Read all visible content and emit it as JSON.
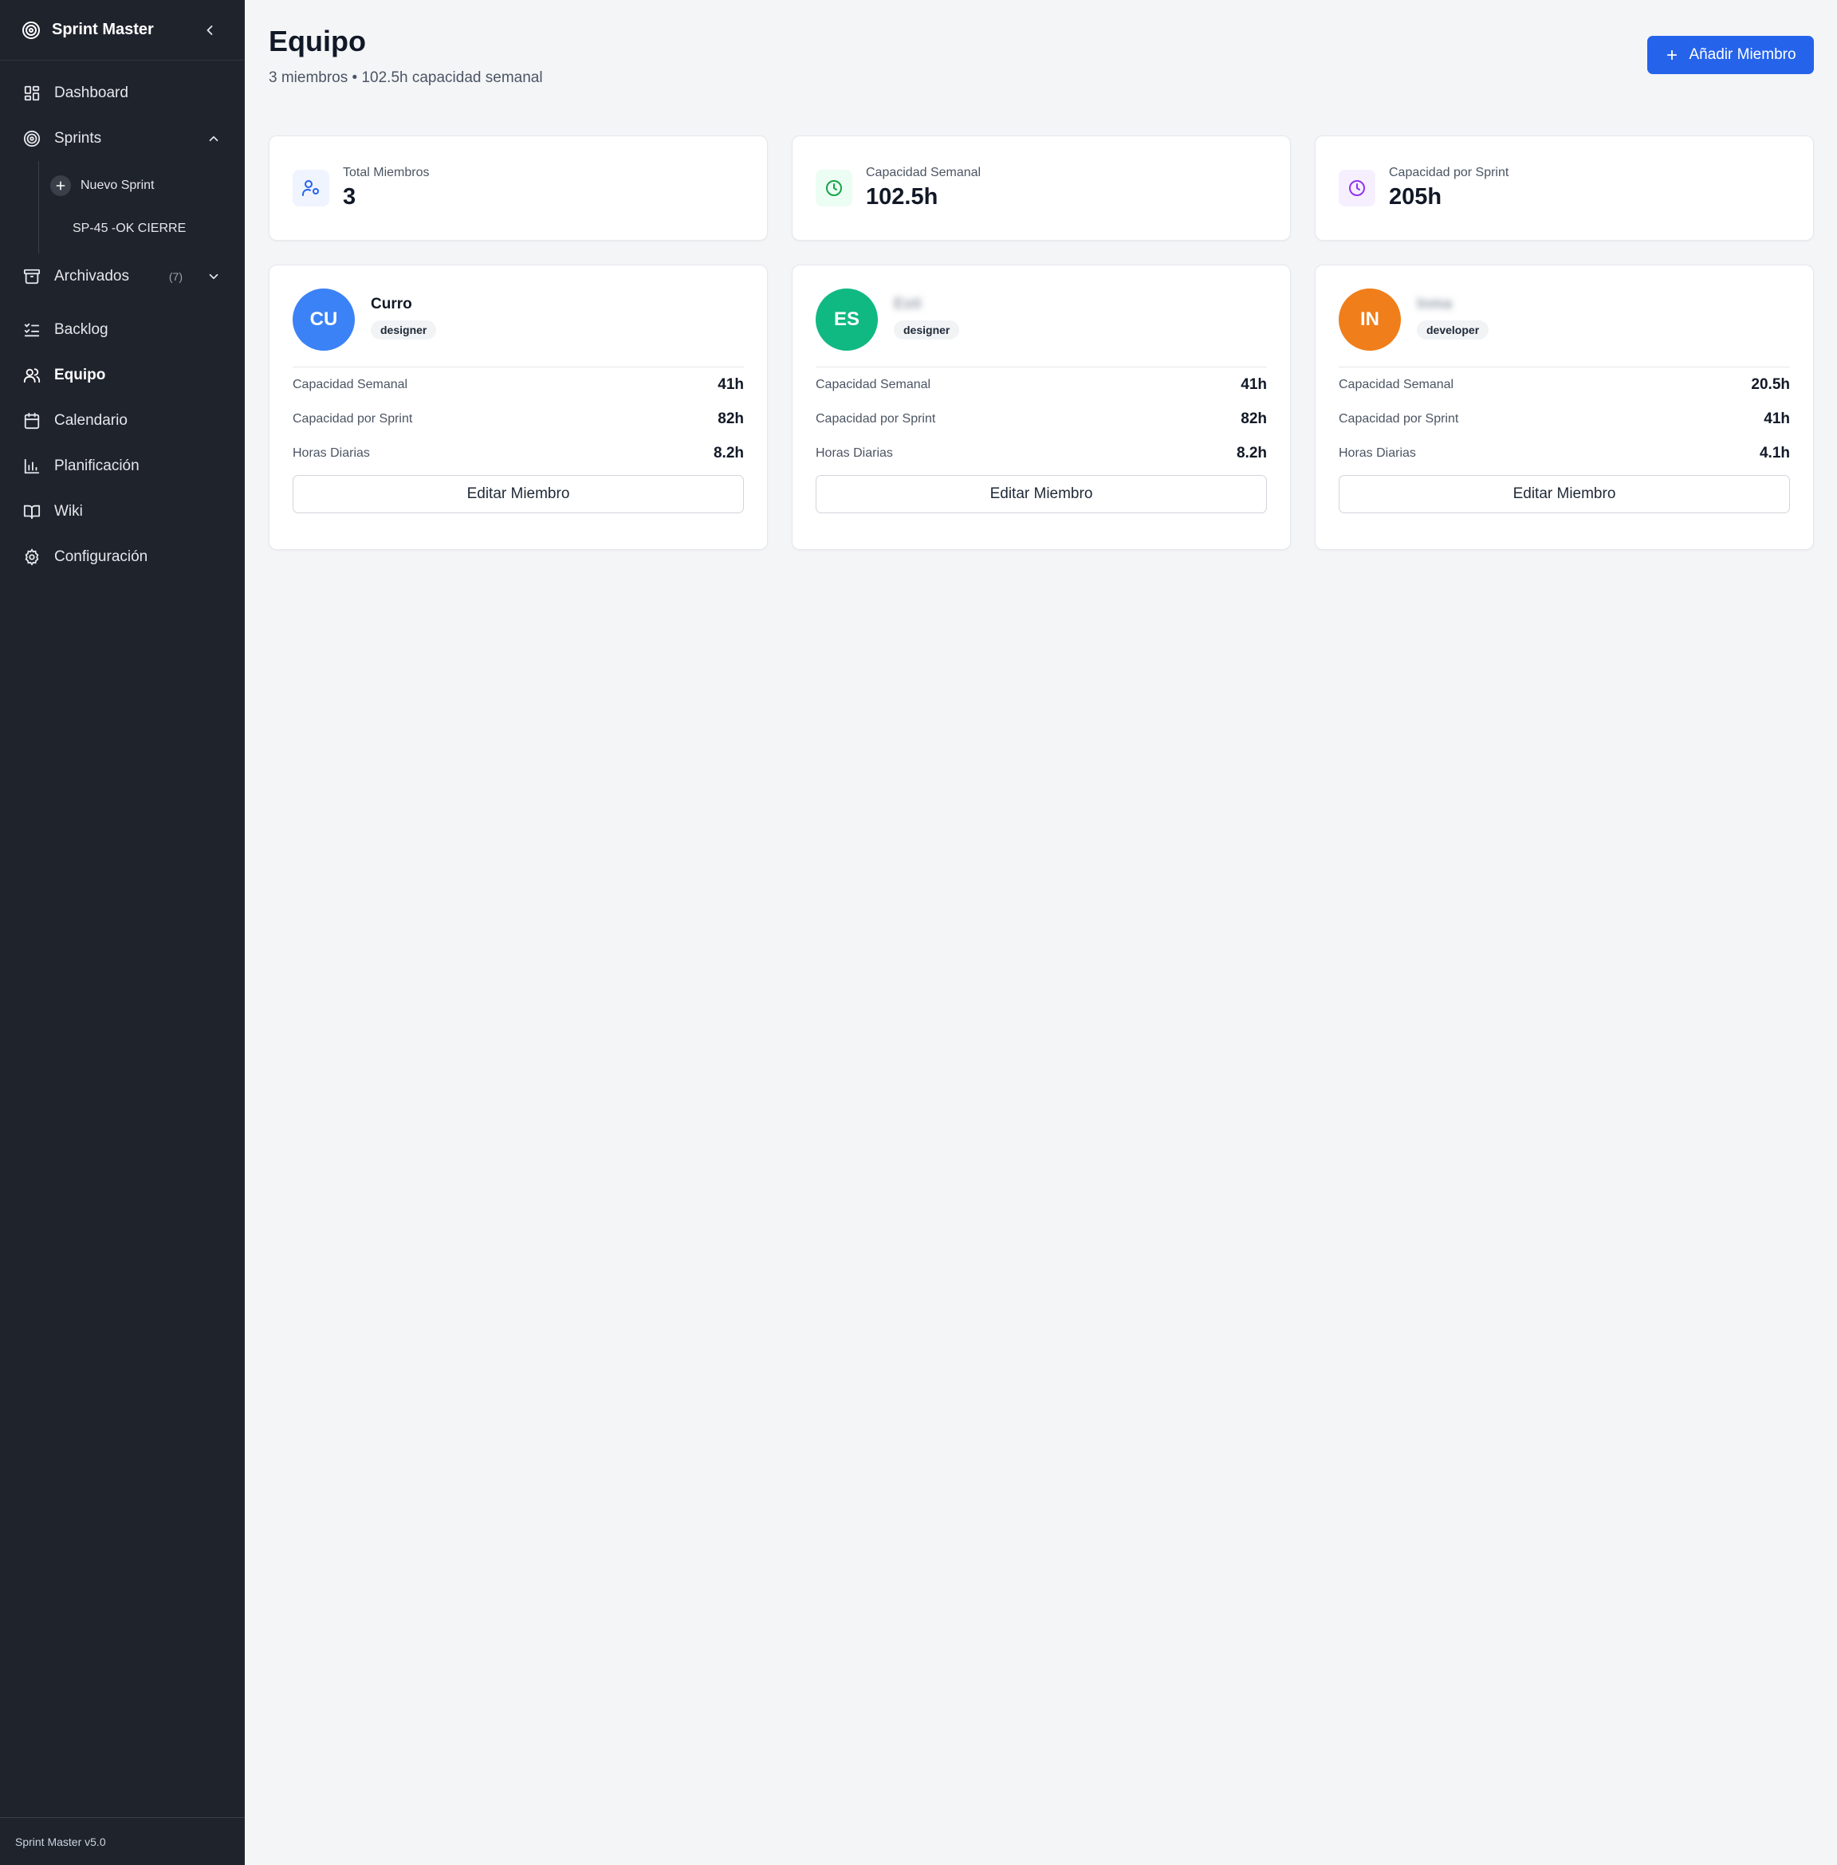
{
  "sidebar": {
    "brand": "Sprint Master",
    "items": [
      {
        "key": "dashboard",
        "label": "Dashboard",
        "icon": "grid-icon"
      },
      {
        "key": "sprints",
        "label": "Sprints",
        "icon": "target-icon"
      },
      {
        "key": "archivados",
        "label": "Archivados",
        "icon": "archive-icon",
        "count": "(7)"
      },
      {
        "key": "backlog",
        "label": "Backlog",
        "icon": "list-checks-icon"
      },
      {
        "key": "equipo",
        "label": "Equipo",
        "icon": "users-icon",
        "active": true
      },
      {
        "key": "calendario",
        "label": "Calendario",
        "icon": "calendar-icon"
      },
      {
        "key": "planificacion",
        "label": "Planificación",
        "icon": "bar-chart-icon"
      },
      {
        "key": "wiki",
        "label": "Wiki",
        "icon": "book-icon"
      },
      {
        "key": "configuracion",
        "label": "Configuración",
        "icon": "gear-icon"
      }
    ],
    "sprints_sub": {
      "new_sprint": "Nuevo Sprint",
      "sprint_item": "SP-45 -OK CIERRE"
    },
    "footer": "Sprint Master v5.0"
  },
  "header": {
    "title": "Equipo",
    "subtitle": "3 miembros • 102.5h capacidad semanal",
    "add_button": "Añadir Miembro"
  },
  "stats": [
    {
      "label": "Total Miembros",
      "value": "3",
      "icon": "user-cog-icon",
      "color": "#2563eb",
      "bg": "#eff4ff"
    },
    {
      "label": "Capacidad Semanal",
      "value": "102.5h",
      "icon": "clock-icon",
      "color": "#16a34a",
      "bg": "#ecfdf3"
    },
    {
      "label": "Capacidad por Sprint",
      "value": "205h",
      "icon": "clock-icon",
      "color": "#9333ea",
      "bg": "#f5efff"
    }
  ],
  "members": [
    {
      "initials": "CU",
      "name": "Curro",
      "role": "designer",
      "color": "#3b82f6",
      "metrics": [
        {
          "label": "Capacidad Semanal",
          "value": "41h"
        },
        {
          "label": "Capacidad por Sprint",
          "value": "82h"
        },
        {
          "label": "Horas Diarias",
          "value": "8.2h"
        }
      ],
      "edit": "Editar Miembro"
    },
    {
      "initials": "ES",
      "name": "Esti",
      "role": "designer",
      "color": "#10b981",
      "metrics": [
        {
          "label": "Capacidad Semanal",
          "value": "41h"
        },
        {
          "label": "Capacidad por Sprint",
          "value": "82h"
        },
        {
          "label": "Horas Diarias",
          "value": "8.2h"
        }
      ],
      "edit": "Editar Miembro"
    },
    {
      "initials": "IN",
      "name": "Inma",
      "role": "developer",
      "color": "#f07e1a",
      "metrics": [
        {
          "label": "Capacidad Semanal",
          "value": "20.5h"
        },
        {
          "label": "Capacidad por Sprint",
          "value": "41h"
        },
        {
          "label": "Horas Diarias",
          "value": "4.1h"
        }
      ],
      "edit": "Editar Miembro"
    }
  ]
}
